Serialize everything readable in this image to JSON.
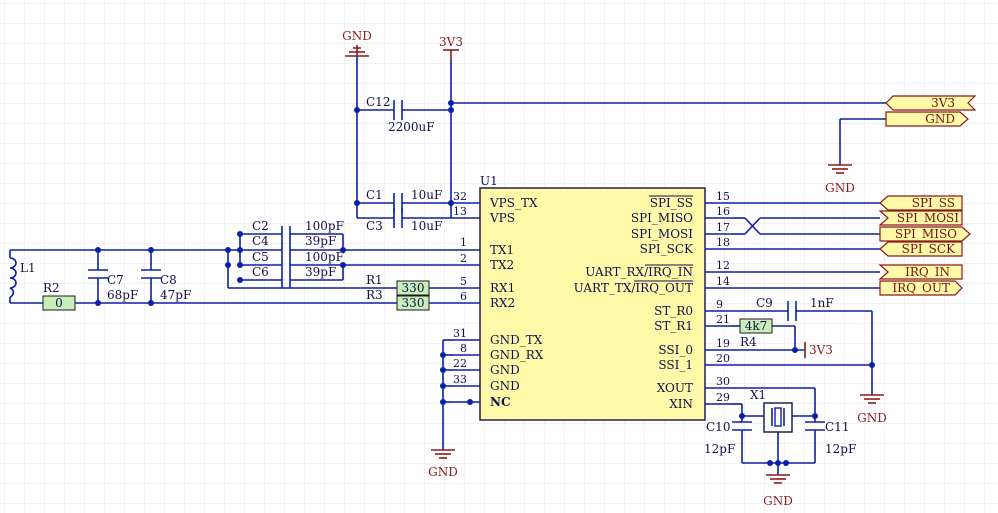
{
  "chip": {
    "ref": "U1",
    "left_pins": [
      {
        "name": "VPS_TX",
        "num": "32"
      },
      {
        "name": "VPS",
        "num": "13"
      },
      {
        "name": "TX1",
        "num": "1"
      },
      {
        "name": "TX2",
        "num": "2"
      },
      {
        "name": "RX1",
        "num": "5"
      },
      {
        "name": "RX2",
        "num": "6"
      },
      {
        "name": "GND_TX",
        "num": "31"
      },
      {
        "name": "GND_RX",
        "num": "8"
      },
      {
        "name": "GND",
        "num": "22"
      },
      {
        "name": "GND",
        "num": "33"
      },
      {
        "name": "NC",
        "num": ""
      }
    ],
    "right_pins": [
      {
        "name": "SPI_SS",
        "num": "15"
      },
      {
        "name": "SPI_MISO",
        "num": "16"
      },
      {
        "name": "SPI_MOSI",
        "num": "17"
      },
      {
        "name": "SPI_SCK",
        "num": "18"
      },
      {
        "name": "UART_RX/IRQ_IN",
        "num": "12"
      },
      {
        "name": "UART_TX/IRQ_OUT",
        "num": "14"
      },
      {
        "name": "ST_R0",
        "num": "9"
      },
      {
        "name": "ST_R1",
        "num": "21"
      },
      {
        "name": "SSI_0",
        "num": "19"
      },
      {
        "name": "SSI_1",
        "num": "20"
      },
      {
        "name": "XOUT",
        "num": "30"
      },
      {
        "name": "XIN",
        "num": "29"
      }
    ]
  },
  "components": {
    "c12": {
      "ref": "C12",
      "value": "2200uF"
    },
    "c1": {
      "ref": "C1",
      "value": "10uF"
    },
    "c3": {
      "ref": "C3",
      "value": "10uF"
    },
    "c2": {
      "ref": "C2",
      "value": "100pF"
    },
    "c4": {
      "ref": "C4",
      "value": "39pF"
    },
    "c5": {
      "ref": "C5",
      "value": "100pF"
    },
    "c6": {
      "ref": "C6",
      "value": "39pF"
    },
    "c7": {
      "ref": "C7",
      "value": "68pF"
    },
    "c8": {
      "ref": "C8",
      "value": "47pF"
    },
    "c9": {
      "ref": "C9",
      "value": "1nF"
    },
    "c10": {
      "ref": "C10",
      "value": "12pF"
    },
    "c11": {
      "ref": "C11",
      "value": "12pF"
    },
    "r1": {
      "ref": "R1",
      "value": "330"
    },
    "r3": {
      "ref": "R3",
      "value": "330"
    },
    "r2": {
      "ref": "R2",
      "value": "0"
    },
    "r4": {
      "ref": "R4",
      "value": "4k7"
    },
    "l1": {
      "ref": "L1"
    },
    "x1": {
      "ref": "X1"
    }
  },
  "power": {
    "gnd": "GND",
    "v33": "3V3"
  },
  "ports": {
    "v33": "3V3",
    "gnd": "GND",
    "spi_ss": "SPI_SS",
    "spi_mosi": "SPI_MOSI",
    "spi_miso": "SPI_MISO",
    "spi_sck": "SPI_SCK",
    "irq_in": "IRQ_IN",
    "irq_out": "IRQ_OUT"
  },
  "colors": {
    "background": "#ffffff",
    "grid": "#e3e3e3",
    "wire": "#0b1fa8",
    "chip_fill": "#fff9a8",
    "port_fill": "#fff9a8",
    "power": "#8b1a1a",
    "resistor_fill": "#c9eeba"
  }
}
